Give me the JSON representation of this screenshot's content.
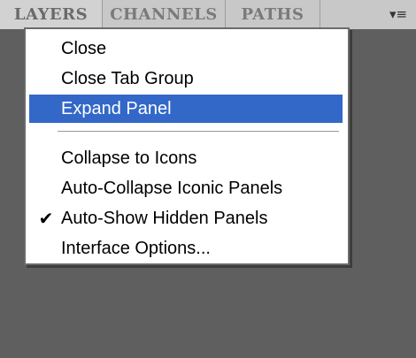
{
  "tabs": [
    {
      "label": "LAYERS",
      "active": true
    },
    {
      "label": "CHANNELS",
      "active": false
    },
    {
      "label": "PATHS",
      "active": false
    }
  ],
  "panel_menu_icon": "panel-menu-icon",
  "menu": {
    "items": [
      {
        "label": "Close",
        "checked": false,
        "selected": false
      },
      {
        "label": "Close Tab Group",
        "checked": false,
        "selected": false
      },
      {
        "label": "Expand Panel",
        "checked": false,
        "selected": true
      },
      {
        "label": "Collapse to Icons",
        "checked": false,
        "selected": false
      },
      {
        "label": "Auto-Collapse Iconic Panels",
        "checked": false,
        "selected": false
      },
      {
        "label": "Auto-Show Hidden Panels",
        "checked": true,
        "selected": false
      },
      {
        "label": "Interface Options...",
        "checked": false,
        "selected": false
      }
    ]
  },
  "colors": {
    "panel_bg": "#5f5f5f",
    "tab_bar": "#d2d2d2",
    "menu_selection": "#3368c8"
  }
}
